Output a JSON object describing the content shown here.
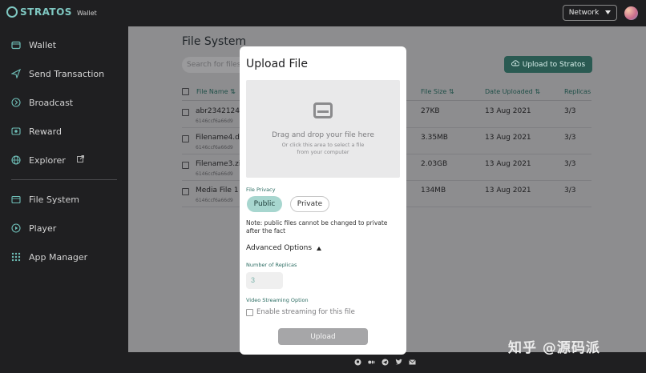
{
  "app": {
    "logo_text": "STRATOS",
    "logo_sub": "Wallet"
  },
  "sidebar": {
    "items": [
      {
        "label": "Wallet",
        "icon": "wallet-icon"
      },
      {
        "label": "Send Transaction",
        "icon": "send-icon"
      },
      {
        "label": "Broadcast",
        "icon": "broadcast-icon"
      },
      {
        "label": "Reward",
        "icon": "reward-icon"
      },
      {
        "label": "Explorer",
        "icon": "globe-icon"
      },
      {
        "label": "File System",
        "icon": "folder-icon"
      },
      {
        "label": "Player",
        "icon": "play-icon"
      },
      {
        "label": "App Manager",
        "icon": "grid-icon"
      }
    ]
  },
  "topbar": {
    "network_label": "Network"
  },
  "main": {
    "title": "File System",
    "search_placeholder": "Search for files",
    "upload_button": "Upload to Stratos",
    "columns": [
      "File Name",
      "File Size",
      "Date Uploaded",
      "Replicas"
    ],
    "rows": [
      {
        "name": "abr2342124h",
        "hash": "6146ccf6a66d9",
        "size": "27KB",
        "date": "13 Aug 2021",
        "replicas": "3/3"
      },
      {
        "name": "Filename4.d",
        "hash": "6146ccf6a66d9",
        "size": "3.35MB",
        "date": "13 Aug 2021",
        "replicas": "3/3"
      },
      {
        "name": "Filename3.zi",
        "hash": "6146ccf6a66d9",
        "size": "2.03GB",
        "date": "13 Aug 2021",
        "replicas": "3/3"
      },
      {
        "name": "Media File 1",
        "hash": "6146ccf6a66d9",
        "size": "134MB",
        "date": "13 Aug 2021",
        "replicas": "3/3"
      }
    ]
  },
  "modal": {
    "title": "Upload File",
    "drop_main": "Drag and drop your file here",
    "drop_sub": "Or click this area to select a file from your computer",
    "privacy_label": "File Privacy",
    "public_label": "Public",
    "private_label": "Private",
    "note": "Note: public files cannot be changed to private after the fact",
    "advanced_label": "Advanced Options",
    "replicas_label": "Number of Replicas",
    "replicas_value": "3",
    "streaming_label": "Video Streaming Option",
    "streaming_checkbox": "Enable streaming for this file",
    "upload_label": "Upload"
  },
  "footer": {
    "icons": [
      "github-icon",
      "medium-icon",
      "telegram-icon",
      "twitter-icon",
      "mail-icon"
    ]
  },
  "watermark": "知乎 @源码派",
  "colors": {
    "accent": "#7fc8c2",
    "primary_button": "#2a5a52",
    "public_pill": "#a7d6cf"
  }
}
